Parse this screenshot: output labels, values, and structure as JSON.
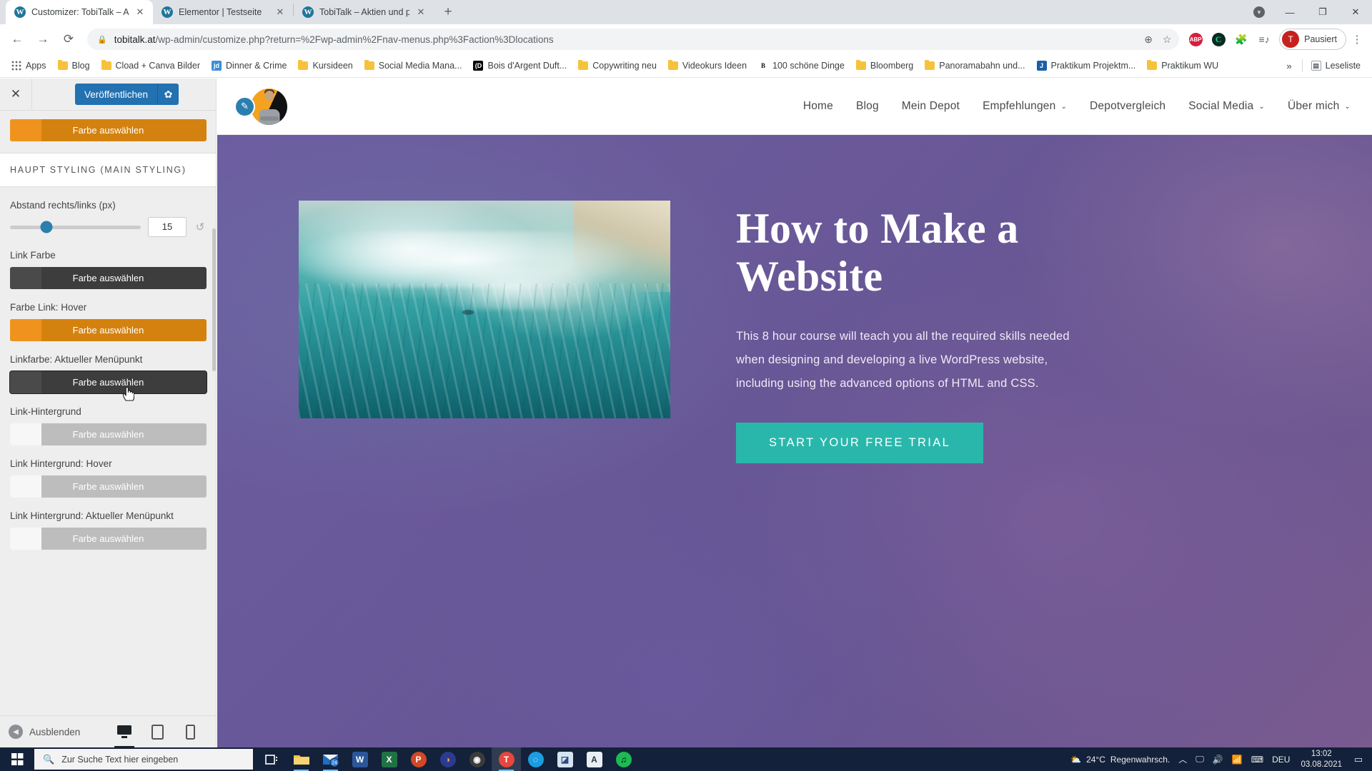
{
  "browser": {
    "tabs": [
      {
        "title": "Customizer: TobiTalk – Aktien un",
        "favicon": "W",
        "active": true,
        "close_icon": "✕"
      },
      {
        "title": "Elementor | Testseite",
        "favicon": "W",
        "active": false,
        "close_icon": "✕"
      },
      {
        "title": "TobiTalk – Aktien und persönliche",
        "favicon": "W",
        "active": false,
        "close_icon": "✕"
      }
    ],
    "new_tab_icon": "+",
    "window_controls": {
      "update_icon": "▾",
      "minimize": "—",
      "maximize": "❐",
      "close": "✕"
    },
    "nav": {
      "back_icon": "←",
      "forward_icon": "→",
      "reload_icon": "⟳"
    },
    "omnibox": {
      "lock_icon": "🔒",
      "host": "tobitalk.at",
      "path": "/wp-admin/customize.php?return=%2Fwp-admin%2Fnav-menus.php%3Faction%3Dlocations",
      "zoom_icon": "⊕",
      "bookmark_icon": "☆"
    },
    "extensions": [
      {
        "name": "adblock-plus-extension",
        "label": "ABP"
      },
      {
        "name": "grammar-extension",
        "label": "C"
      },
      {
        "name": "extensions-puzzle",
        "label": "🧩"
      },
      {
        "name": "reading-list",
        "label": "≡♪"
      }
    ],
    "profile": {
      "initial": "T",
      "label": "Pausiert"
    },
    "menu_icon": "⋮",
    "bookmarks": [
      {
        "label": "Apps",
        "icon": "apps-grid"
      },
      {
        "label": "Blog",
        "icon": "folder"
      },
      {
        "label": "Cload + Canva Bilder",
        "icon": "folder"
      },
      {
        "label": "Dinner & Crime",
        "icon": "site",
        "badge": "jd",
        "color": "#3c8ed6"
      },
      {
        "label": "Kursideen",
        "icon": "folder"
      },
      {
        "label": "Social Media Mana...",
        "icon": "folder"
      },
      {
        "label": "Bois d'Argent Duft...",
        "icon": "site",
        "badge": "(D",
        "color": "#000000"
      },
      {
        "label": "Copywriting neu",
        "icon": "folder"
      },
      {
        "label": "Videokurs Ideen",
        "icon": "folder"
      },
      {
        "label": "100 schöne Dinge",
        "icon": "site",
        "badge": "B",
        "color": "#ffffff"
      },
      {
        "label": "Bloomberg",
        "icon": "folder"
      },
      {
        "label": "Panoramabahn und...",
        "icon": "folder"
      },
      {
        "label": "Praktikum Projektm...",
        "icon": "site",
        "badge": "J",
        "color": "#1a5fa8"
      },
      {
        "label": "Praktikum WU",
        "icon": "folder"
      }
    ],
    "bookmarks_overflow_icon": "»",
    "reading_list_label": "Leseliste"
  },
  "customizer": {
    "close_icon": "✕",
    "publish_label": "Veröffentlichen",
    "publish_gear_icon": "✿",
    "top_color_control": {
      "label": "Farbe auswählen",
      "swatch": "#f0931e",
      "button_bg": "#d4820f",
      "text_color": "#ffffff"
    },
    "section_title": "HAUPT STYLING (MAIN STYLING)",
    "spacing_control": {
      "label": "Abstand rechts/links (px)",
      "value": "15",
      "reset_icon": "↺"
    },
    "color_controls": [
      {
        "label": "Link Farbe",
        "button_label": "Farbe auswählen",
        "swatch": "#4a4a4a",
        "button_bg": "#3d3d3d",
        "text_color": "#ffffff"
      },
      {
        "label": "Farbe Link: Hover",
        "button_label": "Farbe auswählen",
        "swatch": "#f0931e",
        "button_bg": "#d4820f",
        "text_color": "#ffffff"
      },
      {
        "label": "Linkfarbe: Aktueller Menüpunkt",
        "button_label": "Farbe auswählen",
        "swatch": "#4a4a4a",
        "button_bg": "#3d3d3d",
        "text_color": "#ffffff"
      },
      {
        "label": "Link-Hintergrund",
        "button_label": "Farbe auswählen",
        "swatch": "#f7f7f7",
        "button_bg": "#bdbdbd",
        "text_color": "#ffffff"
      },
      {
        "label": "Link Hintergrund: Hover",
        "button_label": "Farbe auswählen",
        "swatch": "#f7f7f7",
        "button_bg": "#bdbdbd",
        "text_color": "#ffffff"
      },
      {
        "label": "Link Hintergrund: Aktueller Menüpunkt",
        "button_label": "Farbe auswählen",
        "swatch": "#f7f7f7",
        "button_bg": "#bdbdbd",
        "text_color": "#ffffff"
      }
    ],
    "footer": {
      "collapse_label": "Ausblenden",
      "collapse_icon": "◀",
      "devices": [
        {
          "name": "desktop",
          "icon": "🖥",
          "active": true
        },
        {
          "name": "tablet",
          "icon": "▯",
          "active": false
        },
        {
          "name": "mobile",
          "icon": "▮",
          "active": false
        }
      ]
    }
  },
  "site": {
    "logo": {
      "pencil_icon": "✎",
      "alt": "TobiTalk Avatar"
    },
    "nav": [
      {
        "label": "Home",
        "has_dropdown": false
      },
      {
        "label": "Blog",
        "has_dropdown": false
      },
      {
        "label": "Mein Depot",
        "has_dropdown": false
      },
      {
        "label": "Empfehlungen",
        "has_dropdown": true
      },
      {
        "label": "Depotvergleich",
        "has_dropdown": false
      },
      {
        "label": "Social Media",
        "has_dropdown": true
      },
      {
        "label": "Über mich",
        "has_dropdown": true
      }
    ],
    "nav_caret": "⌄",
    "hero": {
      "heading": "How to Make a Website",
      "paragraph": "This 8 hour course will teach you all the required skills needed when designing and developing a live WordPress website, including using the advanced options of HTML and CSS.",
      "cta_label": "START YOUR FREE TRIAL",
      "cta_color": "#2ab7ab"
    }
  },
  "taskbar": {
    "start_icon": "windows-logo",
    "search_placeholder": "Zur Suche Text hier eingeben",
    "search_icon": "🔍",
    "apps": [
      {
        "name": "task-view",
        "label": "⊟",
        "color": "#14213a",
        "text": "#ffffff",
        "shape": "plain"
      },
      {
        "name": "file-explorer",
        "label": "📁",
        "color": "#f5c33b",
        "text": "#8a6d1b",
        "shape": "folder"
      },
      {
        "name": "mail",
        "label": "24",
        "color": "#2b7cd3",
        "text": "#ffffff",
        "shape": "mail"
      },
      {
        "name": "word",
        "label": "W",
        "color": "#2b579a",
        "text": "#ffffff",
        "shape": "sq"
      },
      {
        "name": "excel",
        "label": "X",
        "color": "#207245",
        "text": "#ffffff",
        "shape": "sq"
      },
      {
        "name": "powerpoint",
        "label": "P",
        "color": "#d24726",
        "text": "#ffffff",
        "shape": "circ"
      },
      {
        "name": "audacity",
        "label": "◑",
        "color": "#2b3b8f",
        "text": "#f2a33c",
        "shape": "circ"
      },
      {
        "name": "obs-studio",
        "label": "◉",
        "color": "#3b3b3b",
        "text": "#ffffff",
        "shape": "circ"
      },
      {
        "name": "chrome",
        "label": "T",
        "color": "#e8453c",
        "text": "#ffffff",
        "shape": "circ"
      },
      {
        "name": "edge",
        "label": "◌",
        "color": "#1b9de2",
        "text": "#ffffff",
        "shape": "circ"
      },
      {
        "name": "photo-editor",
        "label": "◪",
        "color": "#d6e4f0",
        "text": "#2b4c7e",
        "shape": "sq"
      },
      {
        "name": "font-viewer",
        "label": "A",
        "color": "#e8eef5",
        "text": "#333333",
        "shape": "sq"
      },
      {
        "name": "spotify",
        "label": "♫",
        "color": "#1db954",
        "text": "#000000",
        "shape": "circ"
      }
    ],
    "tray": {
      "weather_temp": "24°C",
      "weather_text": "Regenwahrsch.",
      "weather_icon": "⛅",
      "chevron_icon": "︿",
      "icons": [
        "🖵",
        "🔊",
        "📶",
        "⌨"
      ],
      "language": "DEU",
      "time": "13:02",
      "date": "03.08.2021",
      "notification_icon": "▭"
    }
  }
}
